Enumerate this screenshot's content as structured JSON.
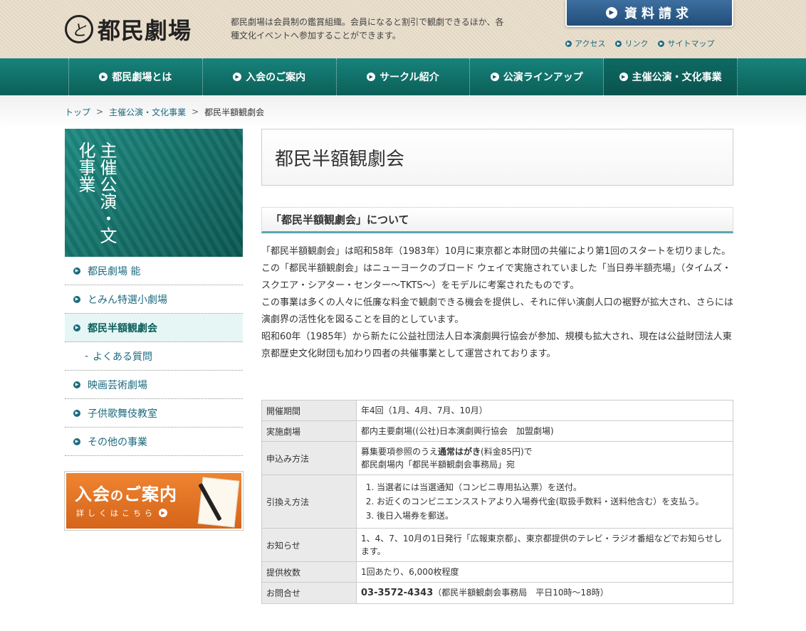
{
  "header": {
    "logo_text": "都民劇場",
    "logo_mark": "と",
    "tagline": "都民劇場は会員制の鑑賞組織。会員になると割引で観劇できるほか、各種文化イベントへ参加することができます。",
    "request_button": "資料請求",
    "util_links": [
      "アクセス",
      "リンク",
      "サイトマップ"
    ]
  },
  "nav": {
    "items": [
      "都民劇場とは",
      "入会のご案内",
      "サークル紹介",
      "公演ラインアップ",
      "主催公演・文化事業"
    ],
    "active_index": 4
  },
  "breadcrumb": {
    "items": [
      "トップ",
      "主催公演・文化事業",
      "都民半額観劇会"
    ],
    "separator": ">"
  },
  "sidebar": {
    "title": "主催公演・文化事業",
    "items": [
      {
        "label": "都民劇場 能"
      },
      {
        "label": "とみん特選小劇場"
      },
      {
        "label": "都民半額観劇会"
      },
      {
        "label": "よくある質問"
      },
      {
        "label": "映画芸術劇場"
      },
      {
        "label": "子供歌舞伎教室"
      },
      {
        "label": "その他の事業"
      }
    ],
    "banner": {
      "title_part1": "入会",
      "title_part2": "の",
      "title_part3": "ご案内",
      "subtitle": "詳しくはこちら"
    }
  },
  "main": {
    "page_title": "都民半額観劇会",
    "section_title": "「都民半額観劇会」について",
    "paragraphs": [
      "「都民半額観劇会」は昭和58年（1983年）10月に東京都と本財団の共催により第1回のスタートを切りました。この「都民半額観劇会」はニューヨークのブロード ウェイで実施されていました「当日券半額売場」（タイムズ・スクエア・シアター・センター～TKTS～）をモデルに考案されたものです。",
      "この事業は多くの人々に低廉な料金で観劇できる機会を提供し、それに伴い演劇人口の裾野が拡大され、さらには演劇界の活性化を図ることを目的としています。",
      "昭和60年（1985年）から新たに公益社団法人日本演劇興行協会が参加、規模も拡大され、現在は公益財団法人東京都歴史文化財団も加わり四者の共催事業として運営されております。"
    ],
    "table": {
      "period_label": "開催期間",
      "period_value": "年4回（1月、4月、7月、10月）",
      "venue_label": "実施劇場",
      "venue_value": "都内主要劇場((公社)日本演劇興行協会　加盟劇場)",
      "apply_label": "申込み方法",
      "apply_value_pre": "募集要項参照のうえ",
      "apply_value_bold": "通常はがき",
      "apply_value_post": "(料金85円)で",
      "apply_value_line2": "都民劇場内「都民半額観劇会事務局」宛",
      "exchange_label": "引換え方法",
      "exchange_steps": [
        "当選者には当選通知（コンビニ専用払込票）を送付。",
        "お近くのコンビニエンスストアより入場券代金(取扱手数料・送料他含む）を支払う。",
        "後日入場券を郵送。"
      ],
      "notice_label": "お知らせ",
      "notice_value": "1、4、7、10月の1日発行「広報東京都」、東京都提供のテレビ・ラジオ番組などでお知らせします。",
      "tickets_label": "提供枚数",
      "tickets_value": "1回あたり、6,000枚程度",
      "contact_label": "お問合せ",
      "contact_phone": "03-3572-4343",
      "contact_note": "（都民半額観劇会事務局　平日10時～18時）"
    }
  }
}
